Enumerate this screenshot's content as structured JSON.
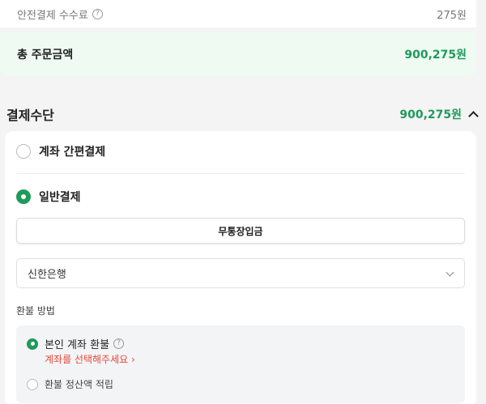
{
  "fee": {
    "label": "안전결제 수수료",
    "help_icon": "?",
    "value": "275원"
  },
  "total": {
    "label": "총 주문금액",
    "value": "900,275원"
  },
  "payment": {
    "title": "결제수단",
    "amount": "900,275원",
    "methods": [
      {
        "label": "계좌 간편결제",
        "selected": false
      },
      {
        "label": "일반결제",
        "selected": true
      }
    ],
    "bank_transfer_button": "무통장입금",
    "bank_select": {
      "value": "신한은행"
    },
    "refund": {
      "title": "환불 방법",
      "options": [
        {
          "label": "본인 계좌 환불",
          "selected": true,
          "help_icon": "?"
        },
        {
          "label": "환불 정산액 적립",
          "selected": false
        }
      ],
      "warning": "계좌를 선택해주세요 ›"
    }
  },
  "colors": {
    "accent": "#1f9a5b",
    "total_bg": "#eefaf2",
    "warning": "#e5483f"
  }
}
